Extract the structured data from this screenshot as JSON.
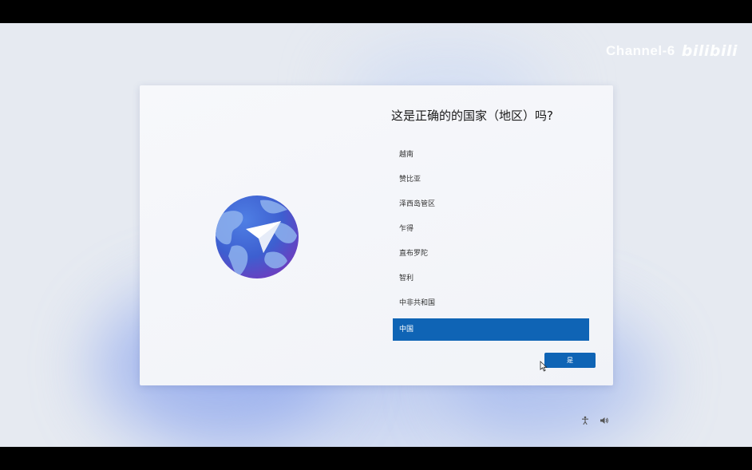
{
  "watermark": {
    "channel": "Channel-6",
    "brand": "bilibili"
  },
  "dialog": {
    "title": "这是正确的的国家（地区）吗?",
    "regions": [
      "越南",
      "赞比亚",
      "泽西岛管区",
      "乍得",
      "直布罗陀",
      "智利",
      "中非共和国",
      "中国"
    ],
    "selected_index": 7,
    "yes_label": "是"
  },
  "tray": {
    "icons": [
      "accessibility-icon",
      "volume-icon"
    ]
  },
  "colors": {
    "accent": "#0f64b5",
    "dialog_bg": "#f4f6fa"
  }
}
